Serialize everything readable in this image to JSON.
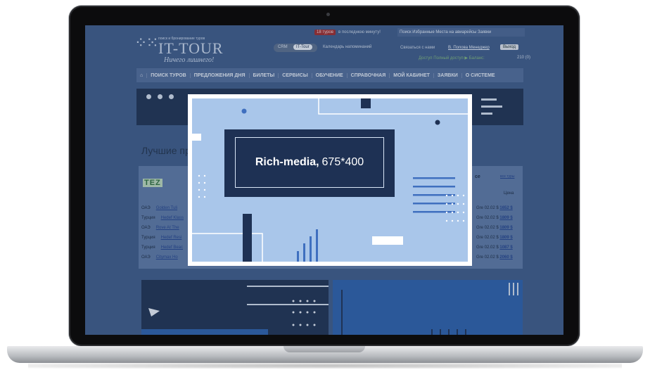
{
  "site": {
    "logo_small": "поиск и бронирование туров",
    "logo_text": "IT-TOUR",
    "logo_slogan": "Ничего лишнего!",
    "top_badge": "18 туров",
    "top_text": "в последнюю минуту!",
    "top_links": "Поиск  Избранные  Места на авиарейсы  Заявки",
    "toggle_crm": "CRM",
    "toggle_ittour": "IT-Tour",
    "calendar_link": "Календарь напоминаний",
    "contact_link": "Связаться с нами",
    "manager_link": "В. Попова Менеджер",
    "exit_button": "Выход",
    "status_text": "Доступ    Полный доступ  ▶  Баланс:",
    "balance_value": "210 (0)",
    "nav": [
      "ПОИСК ТУРОВ",
      "ПРЕДЛОЖЕНИЯ ДНЯ",
      "БИЛЕТЫ",
      "СЕРВИСЫ",
      "ОБУЧЕНИЕ",
      "СПРАВОЧНАЯ",
      "МОЙ КАБИНЕТ",
      "ЗАЯВКИ",
      "О СИСТЕМЕ"
    ],
    "best_title": "Лучшие пр",
    "tez_logo": "TEZ",
    "right_head": "ce",
    "right_all": "все туры",
    "price_label": "Цена",
    "rows": [
      {
        "country": "ОАЭ",
        "hotel": "Golden Tuli",
        "date": "Gre 02.02",
        "currency": "$",
        "price": "1652 $"
      },
      {
        "country": "Турция",
        "hotel": "Hedef Klass",
        "date": "Gre 02.02",
        "currency": "$",
        "price": "1809 $"
      },
      {
        "country": "ОАЭ",
        "hotel": "Rove At The",
        "date": "Gre 02.02",
        "currency": "$",
        "price": "1809 $"
      },
      {
        "country": "Турция",
        "hotel": "Hedef Resi",
        "date": "Gre 02.02",
        "currency": "$",
        "price": "1809 $"
      },
      {
        "country": "Турция",
        "hotel": "Hedef Beac",
        "date": "Gre 02.02",
        "currency": "$",
        "price": "1087 $"
      },
      {
        "country": "ОАЭ",
        "hotel": "Citymax Ho",
        "date": "Gre 02.02",
        "currency": "$",
        "price": "2060 $"
      }
    ]
  },
  "ad": {
    "title_bold": "Rich-media,",
    "title_size": "675*400"
  },
  "colors": {
    "ad_background": "#a9c6ea",
    "ad_dark": "#1e3154",
    "ad_accent": "#3f6fbf"
  }
}
